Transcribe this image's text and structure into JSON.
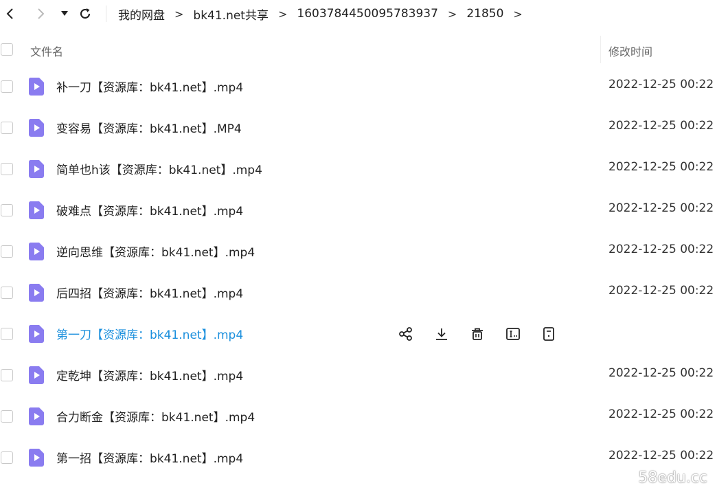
{
  "breadcrumb": [
    "我的网盘",
    "bk41.net共享",
    "1603784450095783937",
    "21850"
  ],
  "crumb_sep": ">",
  "header": {
    "name": "文件名",
    "time": "修改时间"
  },
  "files": [
    {
      "name": "补一刀【资源库：bk41.net】.mp4",
      "time": "2022-12-25 00:22"
    },
    {
      "name": "变容易【资源库：bk41.net】.MP4",
      "time": "2022-12-25 00:22"
    },
    {
      "name": "简单也h该【资源库：bk41.net】.mp4",
      "time": "2022-12-25 00:22"
    },
    {
      "name": "破难点【资源库：bk41.net】.mp4",
      "time": "2022-12-25 00:22"
    },
    {
      "name": "逆向思维【资源库：bk41.net】.mp4",
      "time": "2022-12-25 00:22"
    },
    {
      "name": "后四招【资源库：bk41.net】.mp4",
      "time": "2022-12-25 00:22"
    },
    {
      "name": "第一刀【资源库：bk41.net】.mp4",
      "time": ""
    },
    {
      "name": "定乾坤【资源库：bk41.net】.mp4",
      "time": "2022-12-25 00:22"
    },
    {
      "name": "合力断金【资源库：bk41.net】.mp4",
      "time": "2022-12-25 00:22"
    },
    {
      "name": "第一招【资源库：bk41.net】.mp4",
      "time": "2022-12-25 00:22"
    }
  ],
  "hover_row": 6,
  "hover_actions": [
    "share-icon",
    "download-icon",
    "delete-icon",
    "rename-icon",
    "more-info-icon"
  ],
  "colors": {
    "accent": "#1a8fdd",
    "video_icon": "#8a7cf0"
  },
  "watermark": "58edu.cc"
}
